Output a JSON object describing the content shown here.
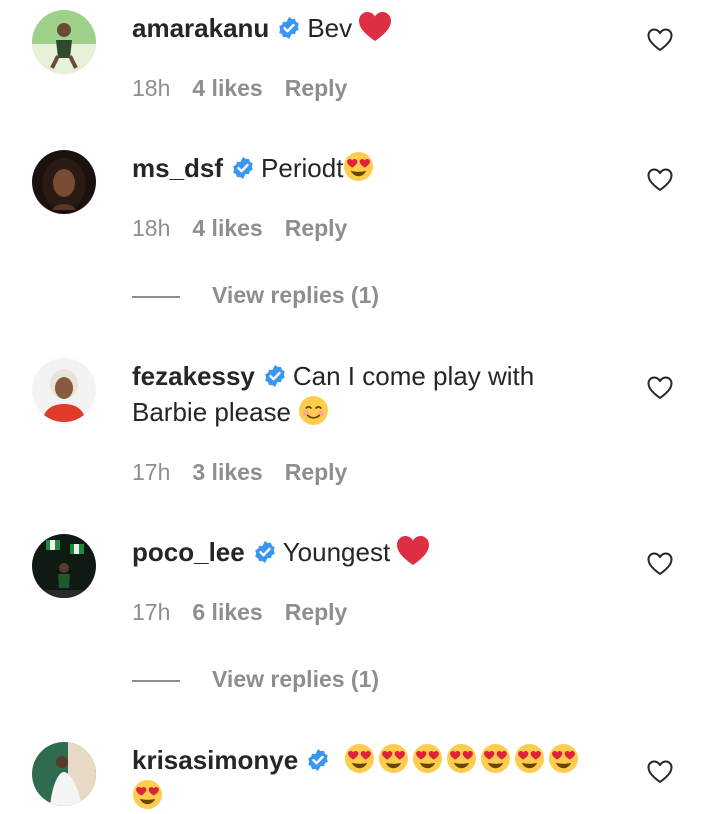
{
  "comments": [
    {
      "username": "amarakanu",
      "verified": true,
      "text": "Bev",
      "emojis": [
        "red-heart"
      ],
      "time": "18h",
      "likes": "4 likes",
      "reply": "Reply",
      "avatar": "avatar-person-green-outfit"
    },
    {
      "username": "ms_dsf",
      "verified": true,
      "text": "Periodt",
      "emojis": [
        "heart-eyes"
      ],
      "time": "18h",
      "likes": "4 likes",
      "reply": "Reply",
      "avatar": "avatar-woman-dark-hair",
      "view_replies": "View replies (1)"
    },
    {
      "username": "fezakessy",
      "verified": true,
      "text_line1": "Can I come play with",
      "text_line2": "Barbie please",
      "emojis": [
        "smiling-face"
      ],
      "time": "17h",
      "likes": "3 likes",
      "reply": "Reply",
      "avatar": "avatar-woman-white-hair-red-top"
    },
    {
      "username": "poco_lee",
      "verified": true,
      "text": "Youngest",
      "emojis": [
        "red-heart"
      ],
      "time": "17h",
      "likes": "6 likes",
      "reply": "Reply",
      "avatar": "avatar-man-with-flags",
      "view_replies": "View replies (1)"
    },
    {
      "username": "krisasimonye",
      "verified": true,
      "emojis": [
        "heart-eyes",
        "heart-eyes",
        "heart-eyes",
        "heart-eyes",
        "heart-eyes",
        "heart-eyes",
        "heart-eyes",
        "heart-eyes"
      ],
      "avatar": "avatar-woman-white-dress"
    }
  ],
  "colors": {
    "text": "#262626",
    "secondary": "#8e8e8e",
    "verified": "#3897f0",
    "heart": "#e0213a"
  }
}
